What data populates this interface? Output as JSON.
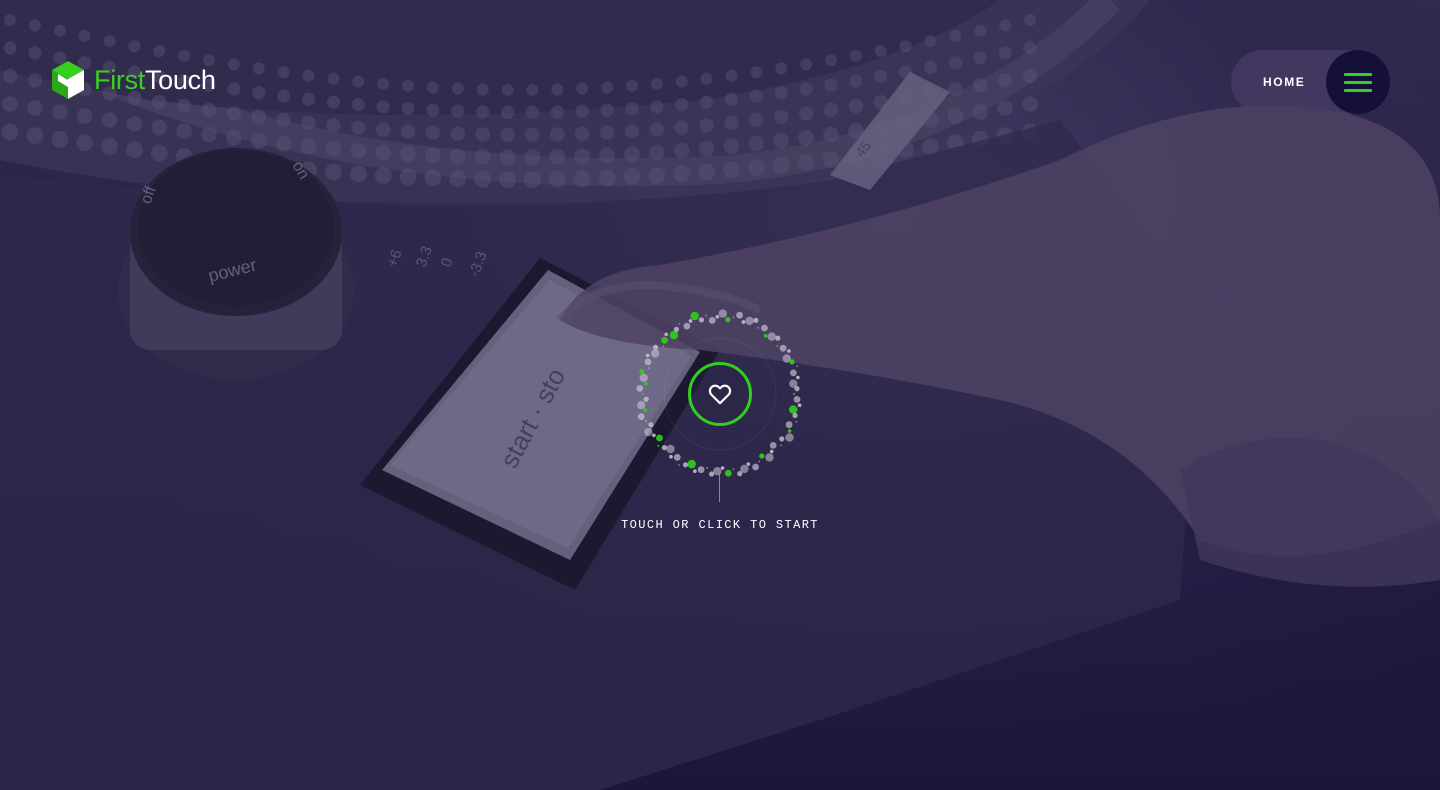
{
  "brand": {
    "name_part1": "First",
    "name_part2": "Touch",
    "accent_color": "#36d11f",
    "icon": "cube-logo-icon"
  },
  "nav": {
    "home_label": "HOME",
    "menu_icon": "hamburger-menu-icon"
  },
  "cta": {
    "icon": "heart-icon",
    "label": "TOUCH OR CLICK TO START"
  },
  "background": {
    "scene": "turntable",
    "knob_labels": {
      "off": "off",
      "on": "on",
      "power": "power"
    },
    "pitch_labels": [
      "+6",
      "3.3",
      "0",
      "-3.3"
    ],
    "button_text": "start · sto",
    "speed_label": "45"
  }
}
